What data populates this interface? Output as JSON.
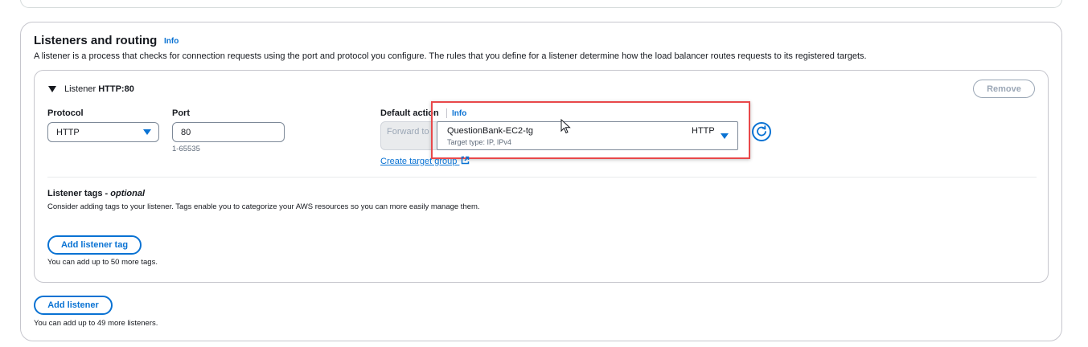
{
  "section": {
    "title": "Listeners and routing",
    "info_label": "Info",
    "description": "A listener is a process that checks for connection requests using the port and protocol you configure. The rules that you define for a listener determine how the load balancer routes requests to its registered targets."
  },
  "listener": {
    "prefix": "Listener",
    "name": "HTTP:80",
    "remove_label": "Remove",
    "protocol": {
      "label": "Protocol",
      "value": "HTTP"
    },
    "port": {
      "label": "Port",
      "value": "80",
      "hint": "1-65535"
    },
    "default_action": {
      "label": "Default action",
      "info_label": "Info",
      "action_value": "Forward to",
      "target_group_name": "QuestionBank-EC2-tg",
      "target_group_type": "Target type: IP, IPv4",
      "target_group_protocol": "HTTP",
      "create_link": "Create target group"
    },
    "tags": {
      "title": "Listener tags - ",
      "title_optional": "optional",
      "description": "Consider adding tags to your listener. Tags enable you to categorize your AWS resources so you can more easily manage them.",
      "add_button": "Add listener tag",
      "hint": "You can add up to 50 more tags."
    }
  },
  "add_listener": {
    "label": "Add listener",
    "hint": "You can add up to 49 more listeners."
  },
  "colors": {
    "accent": "#0972d3",
    "highlight": "#e8484a",
    "border": "#c6c6cd",
    "disabled": "#9ba7b6"
  },
  "icons": [
    "caret-down-icon",
    "dropdown-triangle-icon",
    "refresh-icon",
    "external-link-icon",
    "mouse-cursor-icon"
  ]
}
